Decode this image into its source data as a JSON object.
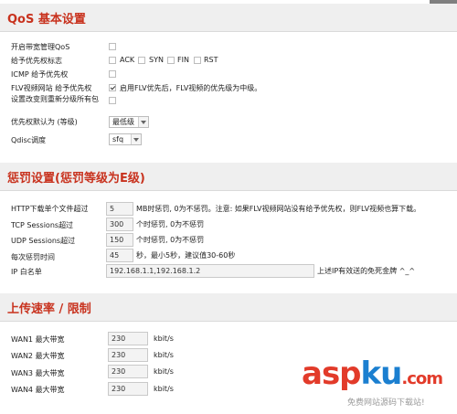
{
  "qos": {
    "title": "QoS 基本设置",
    "enable_label": "开启带宽管理QoS",
    "flag_label": "给予优先权标志",
    "flags": [
      "ACK",
      "SYN",
      "FIN",
      "RST"
    ],
    "icmp_label": "ICMP 给予优先权",
    "flv_label": "FLV视频网站 给予优先权",
    "flv_note": "启用FLV优先后，FLV视频的优先级为中级。",
    "reset_label": "设置改变则重新分级所有包",
    "default_priority_label": "优先权默认为 (等级)",
    "default_priority_value": "最低级",
    "qdisc_label": "Qdisc调度",
    "qdisc_value": "sfq"
  },
  "penalty": {
    "title": "惩罚设置(惩罚等级为E级)",
    "rows": [
      {
        "label": "HTTP下载单个文件超过",
        "value": "5",
        "note": "MB时惩罚, 0为不惩罚。注意: 如果FLV视频网站没有给予优先权，则FLV视频也算下载。"
      },
      {
        "label": "TCP Sessions超过",
        "value": "300",
        "note": "个时惩罚, 0为不惩罚"
      },
      {
        "label": "UDP Sessions超过",
        "value": "150",
        "note": "个时惩罚, 0为不惩罚"
      },
      {
        "label": "每次惩罚时间",
        "value": "45",
        "note": "秒，最小5秒，建议值30-60秒"
      }
    ],
    "ip_label": "IP 白名单",
    "ip_value": "192.168.1.1,192.168.1.2",
    "ip_note": "上述IP有效送的免死金牌 ^_^"
  },
  "upload": {
    "title": "上传速率 / 限制",
    "rows": [
      {
        "label": "WAN1 最大带宽",
        "value": "230",
        "unit": "kbit/s"
      },
      {
        "label": "WAN2 最大带宽",
        "value": "230",
        "unit": "kbit/s"
      },
      {
        "label": "WAN3 最大带宽",
        "value": "230",
        "unit": "kbit/s"
      },
      {
        "label": "WAN4 最大带宽",
        "value": "230",
        "unit": "kbit/s"
      }
    ]
  },
  "watermark": {
    "brand_a": "asp",
    "brand_b": "ku",
    "brand_c": ".com",
    "sub": "免费网站源码下载站!"
  }
}
